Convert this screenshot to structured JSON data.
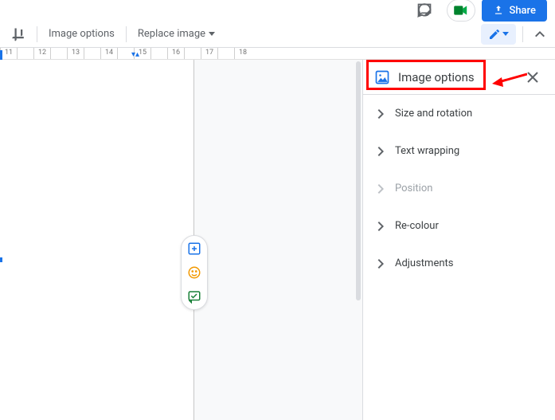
{
  "header": {
    "share_label": "Share"
  },
  "toolbar": {
    "image_options": "Image options",
    "replace_image": "Replace image"
  },
  "ruler": {
    "ticks": [
      "11",
      "",
      "12",
      "",
      "13",
      "",
      "14",
      "",
      "15",
      "",
      "16",
      "",
      "17",
      "",
      "18"
    ]
  },
  "panel": {
    "title": "Image options",
    "items": [
      {
        "label": "Size and rotation",
        "disabled": false
      },
      {
        "label": "Text wrapping",
        "disabled": false
      },
      {
        "label": "Position",
        "disabled": true
      },
      {
        "label": "Re-colour",
        "disabled": false
      },
      {
        "label": "Adjustments",
        "disabled": false
      }
    ]
  }
}
